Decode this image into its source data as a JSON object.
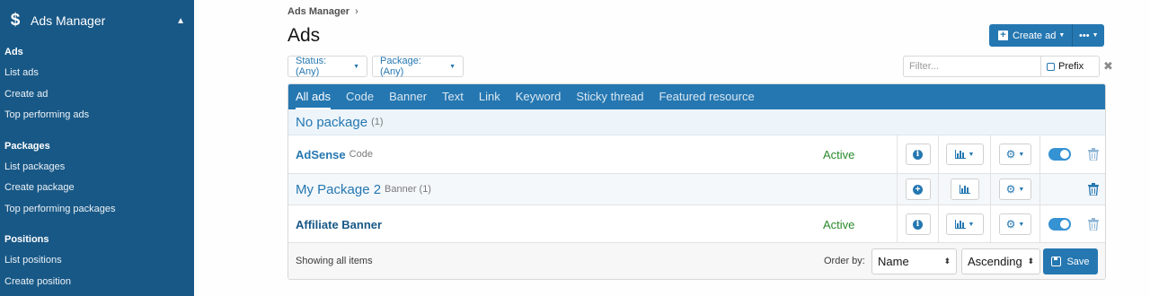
{
  "sidebar": {
    "title": "Ads Manager",
    "icon": "dollar-icon",
    "sections": [
      {
        "heading": "Ads",
        "items": [
          "List ads",
          "Create ad",
          "Top performing ads"
        ]
      },
      {
        "heading": "Packages",
        "items": [
          "List packages",
          "Create package",
          "Top performing packages"
        ]
      },
      {
        "heading": "Positions",
        "items": [
          "List positions",
          "Create position"
        ]
      }
    ]
  },
  "header": {
    "breadcrumb": "Ads Manager",
    "breadcrumb_sep": "›",
    "title": "Ads",
    "create_label": "Create ad",
    "more_label": "•••"
  },
  "filters": {
    "status": "Status: (Any)",
    "package": "Package: (Any)",
    "filter_placeholder": "Filter...",
    "prefix_label": "Prefix",
    "clear": "✖"
  },
  "tabs": [
    "All ads",
    "Code",
    "Banner",
    "Text",
    "Link",
    "Keyword",
    "Sticky thread",
    "Featured resource"
  ],
  "groups": {
    "no_package": {
      "title": "No package",
      "count": "(1)"
    }
  },
  "rows": [
    {
      "name": "AdSense",
      "type": "Code",
      "status": "Active"
    },
    {
      "name": "My Package 2",
      "type": "Banner",
      "count": "(1)"
    },
    {
      "name": "Affiliate Banner",
      "status": "Active"
    }
  ],
  "footer": {
    "showing": "Showing all items",
    "order_by_label": "Order by:",
    "order_field": "Name",
    "order_dir": "Ascending",
    "save_label": "Save"
  },
  "colors": {
    "sidebar_bg": "#185886",
    "accent": "#2577b1",
    "active_status": "#2a8a2a"
  }
}
